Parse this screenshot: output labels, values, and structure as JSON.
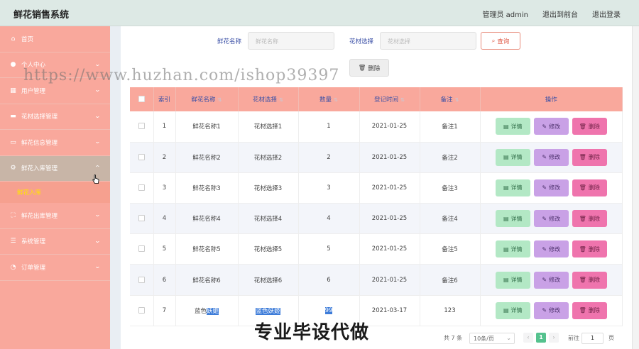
{
  "header": {
    "app_title": "鲜花销售系统",
    "admin_label": "管理员 admin",
    "to_front_label": "退出到前台",
    "logout_label": "退出登录"
  },
  "sidebar": {
    "items": [
      {
        "label": "首页",
        "icon": "home-icon"
      },
      {
        "label": "个人中心",
        "icon": "user-icon"
      },
      {
        "label": "用户管理",
        "icon": "grid-icon"
      },
      {
        "label": "花材选择管理",
        "icon": "monitor-icon"
      },
      {
        "label": "鲜花信息管理",
        "icon": "message-icon"
      },
      {
        "label": "鲜花入库管理",
        "icon": "settings-icon"
      },
      {
        "label": "鲜花出库管理",
        "icon": "frame-icon"
      },
      {
        "label": "系统管理",
        "icon": "sliders-icon"
      },
      {
        "label": "订单管理",
        "icon": "gauge-icon"
      }
    ],
    "submenu_label": "鲜花入库"
  },
  "search": {
    "name_label": "鲜花名称",
    "name_placeholder": "鲜花名称",
    "material_label": "花材选择",
    "material_placeholder": "花材选择",
    "query_label": "查询",
    "delete_label": "删除"
  },
  "table": {
    "headers": {
      "index": "索引",
      "name": "鲜花名称",
      "material": "花材选择",
      "quantity": "数量",
      "date": "登记时间",
      "note": "备注",
      "ops": "操作"
    },
    "ops": {
      "detail": "详情",
      "edit": "修改",
      "delete": "删除"
    },
    "rows": [
      {
        "index": "1",
        "name": "鲜花名称1",
        "material": "花材选择1",
        "quantity": "1",
        "date": "2021-01-25",
        "note": "备注1"
      },
      {
        "index": "2",
        "name": "鲜花名称2",
        "material": "花材选择2",
        "quantity": "2",
        "date": "2021-01-25",
        "note": "备注2"
      },
      {
        "index": "3",
        "name": "鲜花名称3",
        "material": "花材选择3",
        "quantity": "3",
        "date": "2021-01-25",
        "note": "备注3"
      },
      {
        "index": "4",
        "name": "鲜花名称4",
        "material": "花材选择4",
        "quantity": "4",
        "date": "2021-01-25",
        "note": "备注4"
      },
      {
        "index": "5",
        "name": "鲜花名称5",
        "material": "花材选择5",
        "quantity": "5",
        "date": "2021-01-25",
        "note": "备注5"
      },
      {
        "index": "6",
        "name": "鲜花名称6",
        "material": "花材选择6",
        "quantity": "6",
        "date": "2021-01-25",
        "note": "备注6"
      },
      {
        "index": "7",
        "name_a": "蓝色",
        "name_b": "妖姬",
        "material": "蓝色妖姬",
        "quantity": "99",
        "date": "2021-03-17",
        "note": "123"
      }
    ]
  },
  "pagination": {
    "total_label": "共 7 条",
    "page_size_label": "10条/页",
    "current_page": "1",
    "goto_label": "前往",
    "goto_value": "1",
    "page_unit": "页"
  },
  "overlays": {
    "watermark_text": "https://www.huzhan.com/ishop39397",
    "stamp_text": "专业毕设代做"
  },
  "colors": {
    "header_bg": "#dde9e5",
    "sidebar_bg": "#f9a89c",
    "sidebar_active": "#c8b5a7",
    "submenu_text": "#ffe600",
    "detail_btn": "#b3e8c5",
    "edit_btn": "#c9a1e6",
    "delete_btn": "#ef74ad",
    "pager_active": "#55c28e"
  }
}
